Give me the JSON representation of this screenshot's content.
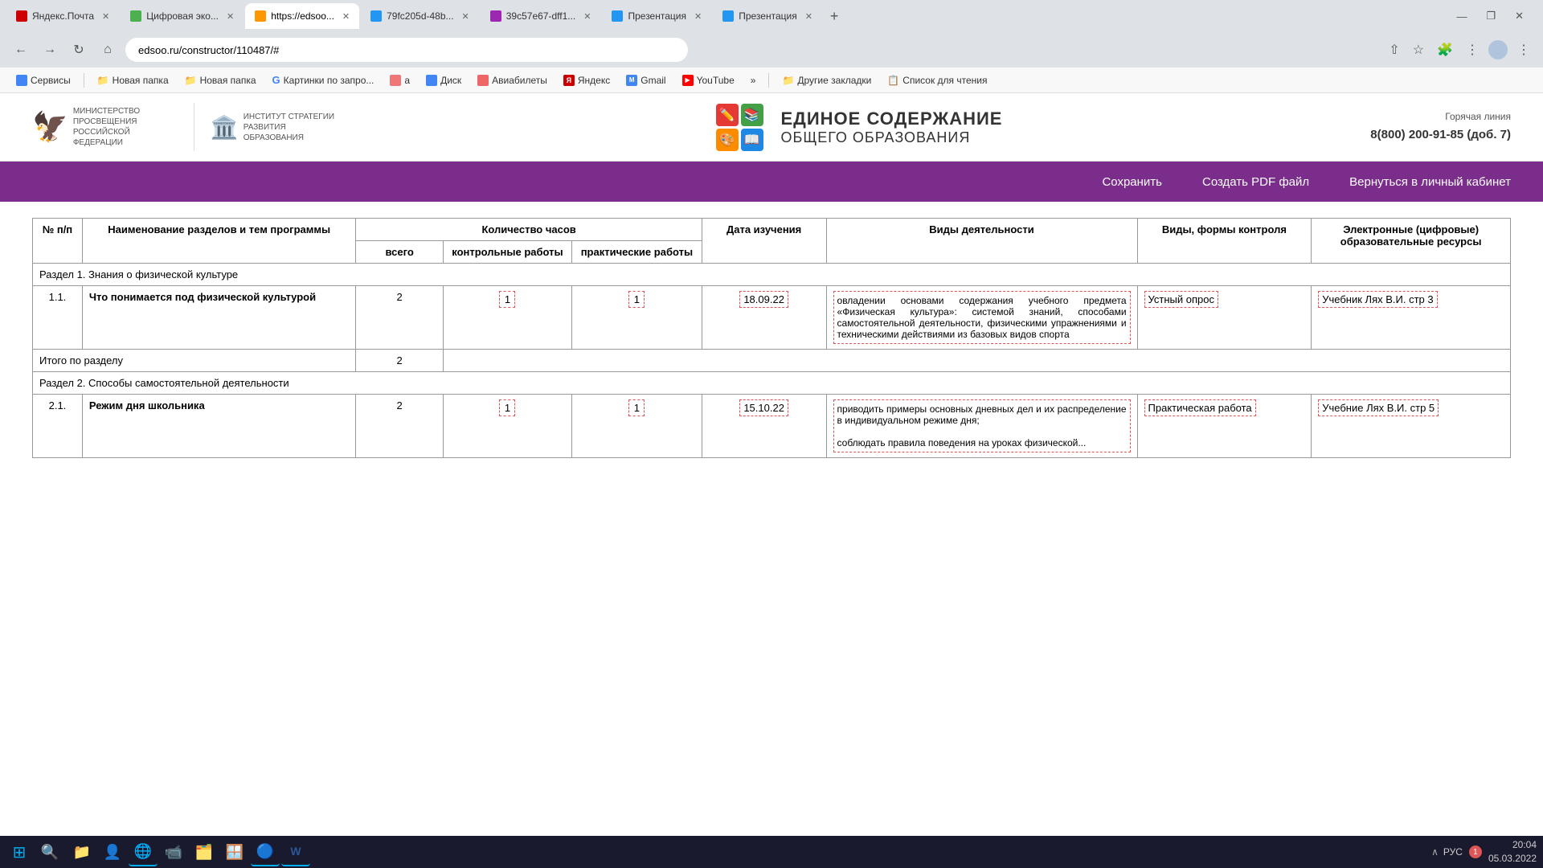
{
  "browser": {
    "tabs": [
      {
        "id": "tab1",
        "label": "Яндекс.Почта",
        "favicon_color": "#c00",
        "active": false
      },
      {
        "id": "tab2",
        "label": "Цифровая эко...",
        "favicon_color": "#4caf50",
        "active": false
      },
      {
        "id": "tab3",
        "label": "https://edsoo...",
        "favicon_color": "#ff9800",
        "active": true
      },
      {
        "id": "tab4",
        "label": "79fc205d-48b...",
        "favicon_color": "#2196f3",
        "active": false
      },
      {
        "id": "tab5",
        "label": "39c57e67-dff1...",
        "favicon_color": "#9c27b0",
        "active": false
      },
      {
        "id": "tab6",
        "label": "Презентация",
        "favicon_color": "#2196f3",
        "active": false
      },
      {
        "id": "tab7",
        "label": "Презентация",
        "favicon_color": "#2196f3",
        "active": false
      }
    ],
    "address": "edsoo.ru/constructor/110487/#",
    "bookmarks": [
      {
        "label": "Сервисы",
        "favicon_color": "#4285f4"
      },
      {
        "label": "Новая папка",
        "favicon_color": "#f4c430"
      },
      {
        "label": "Новая папка",
        "favicon_color": "#f4c430"
      },
      {
        "label": "Картинки по запро...",
        "favicon_color": "#4285f4",
        "is_google": true
      },
      {
        "label": "a",
        "favicon_color": "#e77"
      },
      {
        "label": "Диск",
        "favicon_color": "#4285f4"
      },
      {
        "label": "Авиабилеты",
        "favicon_color": "#e66"
      },
      {
        "label": "Яндекс",
        "favicon_color": "#c00"
      },
      {
        "label": "Gmail",
        "favicon_color": "#4285f4"
      },
      {
        "label": "YouTube",
        "favicon_color": "#ff0000"
      }
    ],
    "bookmark_more_label": "»",
    "other_bookmarks_label": "Другие закладки",
    "reading_list_label": "Список для чтения"
  },
  "site": {
    "hotline_label": "Горячая линия",
    "hotline_number": "8(800) 200-91-85 (доб. 7)",
    "title_line1": "ЕДИНОЕ СОДЕРЖАНИЕ",
    "title_line2": "ОБЩЕГО ОБРАЗОВАНИЯ",
    "ministry_label": "МИНИСТЕРСТВО ПРОСВЕЩЕНИЯ РОССИЙСКОЙ ФЕДЕРАЦИИ",
    "institute_label": "ИНСТИТУТ СТРАТЕГИИ РАЗВИТИЯ ОБРАЗОВАНИЯ",
    "nav": {
      "save": "Сохранить",
      "pdf": "Создать PDF файл",
      "back": "Вернуться в личный кабинет"
    }
  },
  "table": {
    "headers": {
      "num": "№ п/п",
      "name": "Наименование разделов и тем программы",
      "hours_group": "Количество часов",
      "hours_total": "всего",
      "hours_control": "контрольные работы",
      "hours_practical": "практические работы",
      "date": "Дата изучения",
      "activities": "Виды деятельности",
      "control_type": "Виды, формы контроля",
      "resources": "Электронные (цифровые) образовательные ресурсы"
    },
    "sections": [
      {
        "id": "section1",
        "title": "Раздел 1. Знания о физической культуре",
        "rows": [
          {
            "num": "1.1.",
            "name": "Что понимается под физической культурой",
            "total": "2",
            "control": "1",
            "practical": "1",
            "date": "18.09.22",
            "activities": "овладении основами содержания учебного предмета «Физическая культура»: системой знаний, способами самостоятельной деятельности, физическими упражнениями и техническими действиями из базовых видов спорта",
            "control_type": "Устный опрос",
            "resources": "Учебник Лях В.И. стр 3"
          }
        ],
        "total_hours": "2"
      },
      {
        "id": "section2",
        "title": "Раздел 2. Способы самостоятельной деятельности",
        "rows": [
          {
            "num": "2.1.",
            "name": "Режим дня школьника",
            "total": "2",
            "control": "1",
            "practical": "1",
            "date": "15.10.22",
            "activities": "приводить примеры основных дневных дел и их распределение в индивидуальном режиме дня;\n\nсоблюдать правила поведения на уроках физической...",
            "control_type": "Практическая работа",
            "resources": "Учебние Лях В.И. стр 5"
          }
        ],
        "total_hours": null
      }
    ],
    "total_label": "Итого по разделу"
  },
  "taskbar": {
    "time": "20:04",
    "date": "05.03.2022",
    "lang": "РУС",
    "notification_count": "1"
  }
}
